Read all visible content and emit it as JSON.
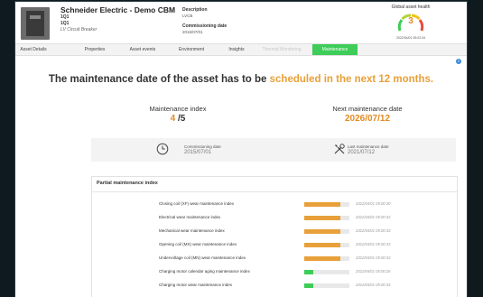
{
  "header": {
    "title": "Schneider Electric - Demo CBM",
    "sub1": "1Q1",
    "sub2": "1Q1",
    "type": "LV Circuit Breaker",
    "description_label": "Description",
    "description_value": "LVCB",
    "commissioning_label": "Commissioning date",
    "commissioning_value": "2015/07/01",
    "health_title": "Global asset health",
    "health_value": "3",
    "health_max": 5,
    "health_date": "2022/04/01 05:02:34",
    "health_color": "#e08c24"
  },
  "tabs": [
    {
      "label": "Asset Details",
      "state": "normal"
    },
    {
      "label": "Properties",
      "state": "normal"
    },
    {
      "label": "Asset events",
      "state": "normal"
    },
    {
      "label": "Environment",
      "state": "normal"
    },
    {
      "label": "Insights",
      "state": "normal"
    },
    {
      "label": "Thermal Monitoring",
      "state": "disabled"
    },
    {
      "label": "Maintenance",
      "state": "active"
    }
  ],
  "main": {
    "headline_prefix": "The maintenance date of the asset has to be ",
    "headline_highlight": "scheduled in the next 12 months.",
    "maintenance_index_label": "Maintenance index",
    "maintenance_index_value": "4",
    "maintenance_index_max": " /5",
    "next_maintenance_label": "Next maintenance date",
    "next_maintenance_value": "2026/07/12",
    "commissioning_label": "Commissioning date",
    "commissioning_value": "2015/07/01",
    "last_maintenance_label": "Last maintenance date",
    "last_maintenance_value": "2021/07/12"
  },
  "partial": {
    "title": "Partial maintenance index",
    "rows": [
      {
        "label": "Closing coil (XF) wear maintenance index",
        "level": 0.8,
        "color": "#e8a03a",
        "ts": "2022/04/01 05:00:30"
      },
      {
        "label": "Electrical wear maintenance index",
        "level": 0.8,
        "color": "#e8a03a",
        "ts": "2022/04/01 05:00:32"
      },
      {
        "label": "Mechanical wear maintenance index",
        "level": 0.8,
        "color": "#e8a03a",
        "ts": "2022/04/01 05:00:33"
      },
      {
        "label": "Opening coil (MX) wear maintenance index",
        "level": 0.8,
        "color": "#e8a03a",
        "ts": "2022/04/01 05:00:33"
      },
      {
        "label": "Undervoltage coil (MN) wear maintenance index",
        "level": 0.8,
        "color": "#e8a03a",
        "ts": "2022/04/01 05:00:33"
      },
      {
        "label": "Charging motor calendar aging maintenance index",
        "level": 0.2,
        "color": "#3dcd58",
        "ts": "2022/04/01 05:00:26"
      },
      {
        "label": "Charging motor wear maintenance index",
        "level": 0.2,
        "color": "#3dcd58",
        "ts": "2022/04/01 05:00:34"
      }
    ]
  },
  "icons": {
    "info": "i",
    "clock": "clock-icon",
    "tools": "tools-icon"
  }
}
